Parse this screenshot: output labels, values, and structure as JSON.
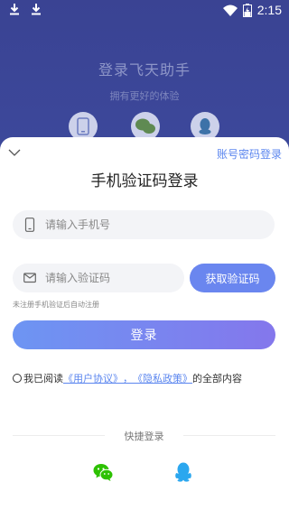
{
  "status_bar": {
    "time": "2:15",
    "left_icons": [
      "download-icon",
      "download-icon"
    ],
    "right_icons": [
      "wifi-icon",
      "battery-charging-icon"
    ]
  },
  "background": {
    "title": "登录飞天助手",
    "subtitle": "拥有更好的体验",
    "icons": [
      "phone-icon",
      "wechat-icon",
      "qq-icon"
    ]
  },
  "sheet": {
    "password_login_link": "账号密码登录",
    "title": "手机验证码登录",
    "phone_placeholder": "请输入手机号",
    "code_placeholder": "请输入验证码",
    "get_code_button": "获取验证码",
    "hint": "未注册手机验证后自动注册",
    "login_button": "登录",
    "agreement": {
      "prefix": "我已阅读",
      "user_agreement": "《用户协议》",
      "separator": "，",
      "privacy_policy": "《隐私政策》",
      "suffix": "的全部内容"
    },
    "quick_login_label": "快捷登录",
    "quick_login_icons": [
      "wechat-icon",
      "qq-icon"
    ]
  },
  "colors": {
    "accent": "#5b86ef",
    "button_gradient_start": "#6d95f3",
    "button_gradient_end": "#8477ec",
    "wechat_green": "#2dc100",
    "qq_blue": "#2ba7ef"
  }
}
